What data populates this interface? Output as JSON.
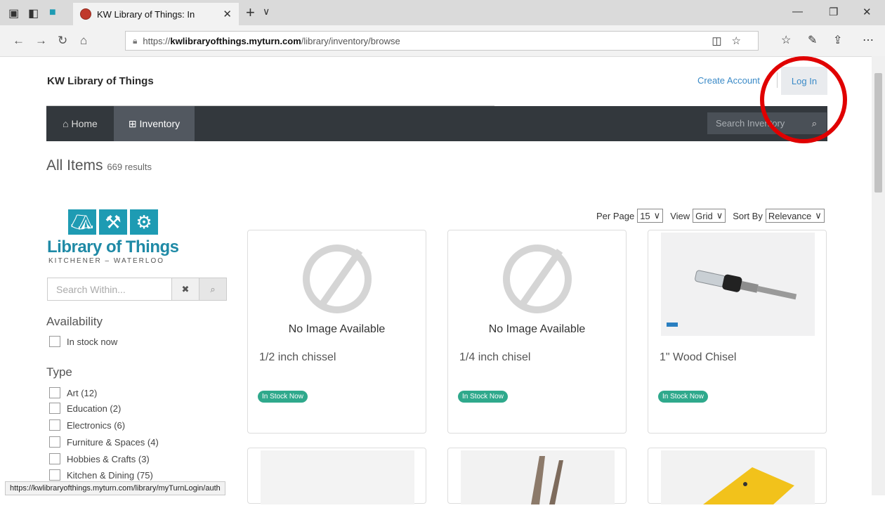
{
  "browser": {
    "tab_title": "KW Library of Things: In",
    "url_prefix": "https://",
    "url_host": "kwlibraryofthings.myturn.com",
    "url_path": "/library/inventory/browse",
    "status_url": "https://kwlibraryofthings.myturn.com/library/myTurnLogin/auth"
  },
  "header": {
    "site_title": "KW Library of Things",
    "create_account": "Create Account",
    "login": "Log In"
  },
  "nav": {
    "home": "Home",
    "inventory": "Inventory",
    "search_placeholder": "Search Inventory"
  },
  "main": {
    "heading": "All Items",
    "results": "669 results"
  },
  "logo": {
    "name": "Library of Things",
    "sub": "KITCHENER – WATERLOO"
  },
  "sidebar": {
    "search_placeholder": "Search Within...",
    "availability_label": "Availability",
    "in_stock": "In stock now",
    "type_label": "Type",
    "types": [
      "Art (12)",
      "Education (2)",
      "Electronics (6)",
      "Furniture & Spaces (4)",
      "Hobbies & Crafts (3)",
      "Kitchen & Dining (75)"
    ]
  },
  "controls": {
    "per_page_label": "Per Page",
    "per_page_value": "15",
    "view_label": "View",
    "view_value": "Grid",
    "sort_label": "Sort By",
    "sort_value": "Relevance"
  },
  "items": [
    {
      "title": "1/2 inch chissel",
      "badge": "In Stock Now",
      "no_image": "No Image Available"
    },
    {
      "title": "1/4 inch chisel",
      "badge": "In Stock Now",
      "no_image": "No Image Available"
    },
    {
      "title": "1\" Wood Chisel",
      "badge": "In Stock Now"
    }
  ]
}
